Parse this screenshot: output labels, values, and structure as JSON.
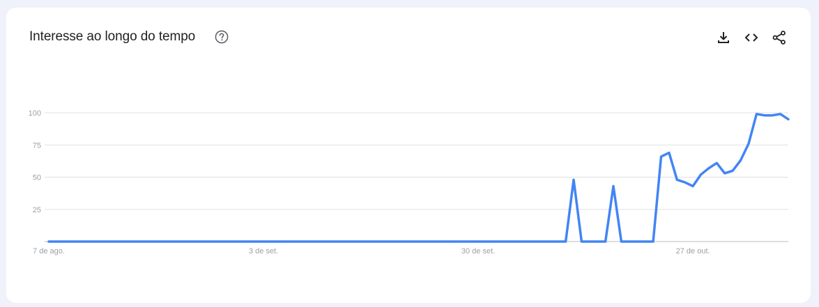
{
  "header": {
    "title": "Interesse ao longo do tempo",
    "help_icon": "help-circle-icon",
    "tools": [
      {
        "name": "download-icon"
      },
      {
        "name": "embed-code-icon"
      },
      {
        "name": "share-icon"
      }
    ]
  },
  "colors": {
    "line": "#4285f4",
    "grid": "#e0e0e0",
    "tick": "#9aa0a6",
    "background": "#eff2fa"
  },
  "chart_data": {
    "type": "line",
    "title": "Interesse ao longo do tempo",
    "xlabel": "",
    "ylabel": "",
    "ylim": [
      0,
      100
    ],
    "y_ticks": [
      25,
      50,
      75,
      100
    ],
    "x_ticks": [
      {
        "label": "7 de ago.",
        "index": 0
      },
      {
        "label": "3 de set.",
        "index": 27
      },
      {
        "label": "30 de set.",
        "index": 54
      },
      {
        "label": "27 de out.",
        "index": 81
      }
    ],
    "grid": true,
    "series": [
      {
        "values": [
          0,
          0,
          0,
          0,
          0,
          0,
          0,
          0,
          0,
          0,
          0,
          0,
          0,
          0,
          0,
          0,
          0,
          0,
          0,
          0,
          0,
          0,
          0,
          0,
          0,
          0,
          0,
          0,
          0,
          0,
          0,
          0,
          0,
          0,
          0,
          0,
          0,
          0,
          0,
          0,
          0,
          0,
          0,
          0,
          0,
          0,
          0,
          0,
          0,
          0,
          0,
          0,
          0,
          0,
          0,
          0,
          0,
          0,
          0,
          0,
          0,
          0,
          0,
          0,
          0,
          0,
          48,
          0,
          0,
          0,
          0,
          43,
          0,
          0,
          0,
          0,
          0,
          66,
          69,
          48,
          46,
          43,
          52,
          57,
          61,
          53,
          55,
          63,
          76,
          99,
          98,
          98,
          99,
          95
        ]
      }
    ]
  }
}
